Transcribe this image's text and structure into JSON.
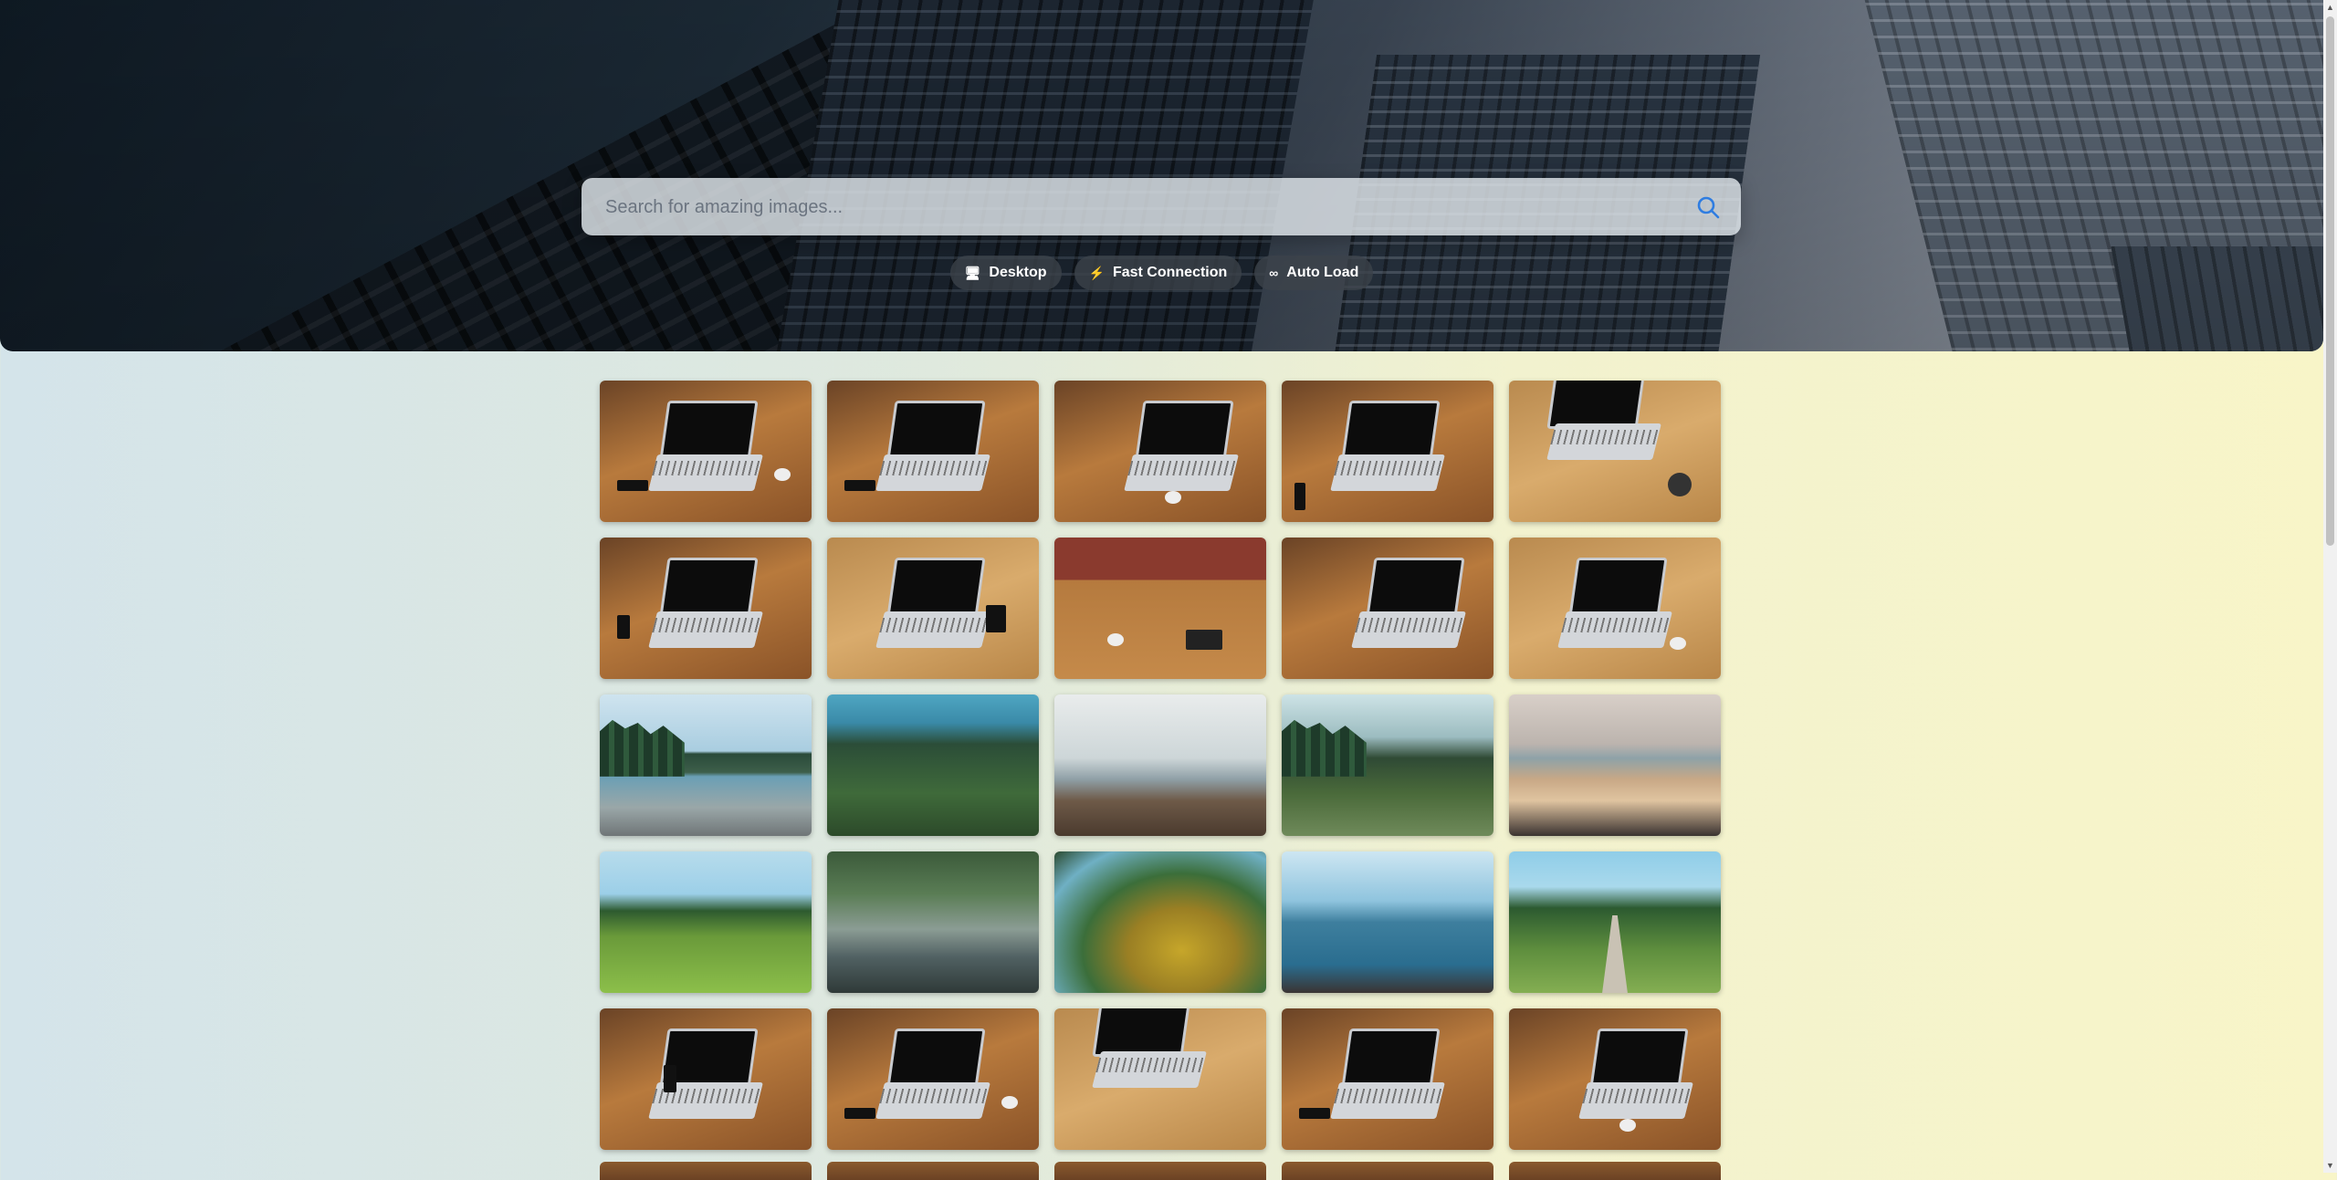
{
  "search": {
    "placeholder": "Search for amazing images..."
  },
  "chips": [
    {
      "icon": "desktop-icon",
      "glyph": "🖥",
      "label": "Desktop"
    },
    {
      "icon": "lightning-icon",
      "glyph": "⚡",
      "label": "Fast Connection"
    },
    {
      "icon": "infinity-icon",
      "glyph": "∞",
      "label": "Auto Load"
    }
  ],
  "colors": {
    "accent": "#2f7de1",
    "chip_bg": "#3c424a"
  },
  "gallery": {
    "rows": [
      [
        "laptop-coffee",
        "laptop-typing",
        "laptop-notebook",
        "laptop-phone",
        "laptop-watch-notes"
      ],
      [
        "laptop-typing-closeup",
        "laptop-wood-table",
        "laptop-brick-wall-meeting",
        "laptop-side-view",
        "laptop-notebook-cup"
      ],
      [
        "pebble-beach",
        "forest-lake",
        "rocky-sea-shore",
        "misty-river-valley",
        "sandy-rocky-shore"
      ],
      [
        "tall-grass",
        "waterfall-rocks",
        "mossy-tree-trunk",
        "lake-mountain-view",
        "forest-path"
      ],
      [
        "laptop-phone",
        "laptop-coffee",
        "laptop-watch-notes",
        "laptop-typing",
        "laptop-notebook"
      ]
    ]
  }
}
